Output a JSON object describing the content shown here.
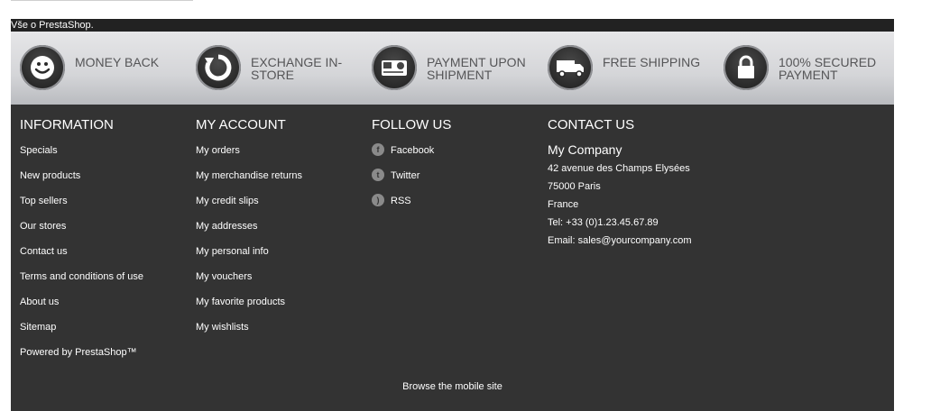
{
  "topbar": {
    "text": "Vše o PrestaShop."
  },
  "reinsurance": [
    {
      "icon": "smiley-icon",
      "label": "MONEY BACK"
    },
    {
      "icon": "exchange-icon",
      "label": "EXCHANGE IN-STORE"
    },
    {
      "icon": "payment-icon",
      "label": "PAYMENT UPON SHIPMENT"
    },
    {
      "icon": "truck-icon",
      "label": "FREE SHIPPING"
    },
    {
      "icon": "lock-icon",
      "label": "100% SECURED PAYMENT"
    }
  ],
  "information": {
    "title": "INFORMATION",
    "links": [
      "Specials",
      "New products",
      "Top sellers",
      "Our stores",
      "Contact us",
      "Terms and conditions of use",
      "About us",
      "Sitemap",
      "Powered by PrestaShop™"
    ]
  },
  "account": {
    "title": "MY ACCOUNT",
    "links": [
      "My orders",
      "My merchandise returns",
      "My credit slips",
      "My addresses",
      "My personal info",
      "My vouchers",
      "My favorite products",
      "My wishlists"
    ]
  },
  "follow": {
    "title": "FOLLOW US",
    "links": [
      {
        "icon": "facebook-icon",
        "label": "Facebook"
      },
      {
        "icon": "twitter-icon",
        "label": "Twitter"
      },
      {
        "icon": "rss-icon",
        "label": "RSS"
      }
    ]
  },
  "contact": {
    "title": "CONTACT US",
    "company": "My Company",
    "address1": "42 avenue des Champs Elysées",
    "address2": "75000 Paris",
    "country": "France",
    "tel": "Tel: +33 (0)1.23.45.67.89",
    "email": "Email: sales@yourcompany.com"
  },
  "mobile_link": "Browse the mobile site",
  "colors": {
    "footer_bg": "#333333",
    "text": "#ffffff",
    "reinsurance_text": "#555557"
  }
}
